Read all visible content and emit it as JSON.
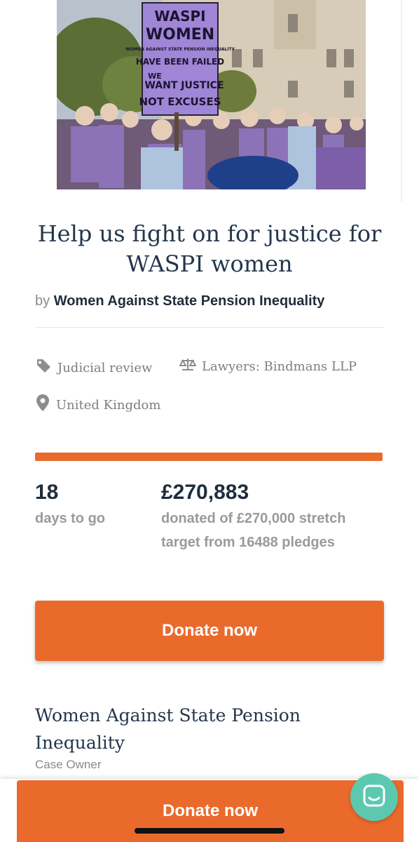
{
  "hero": {
    "image": "campaign-photo",
    "placard_lines": [
      "WASPI",
      "WOMEN",
      "WOMEN AGAINST STATE PENSION INEQUALITY",
      "HAVE BEEN FAILED",
      "WE",
      "WANT JUSTICE",
      "NOT EXCUSES"
    ]
  },
  "campaign": {
    "title": "Help us fight on for justice for WASPI women",
    "by_label": "by",
    "owner": "Women Against State Pension Inequality"
  },
  "meta": {
    "case_type": "Judicial review",
    "lawyers": "Lawyers: Bindmans LLP",
    "location": "United Kingdom",
    "icons": {
      "case_type": "tag-icon",
      "lawyers": "scales-icon",
      "location": "map-pin-icon"
    }
  },
  "stats": {
    "progress_fraction": 1.0,
    "days_left": "18",
    "days_label": "days to go",
    "amount_raised": "£270,883",
    "amount_caption": "donated of £270,000 stretch target from 16488 pledges"
  },
  "actions": {
    "donate_label": "Donate now",
    "sticky_donate_label": "Donate now"
  },
  "case_owner": {
    "name": "Women Against State Pension Inequality",
    "role": "Case Owner"
  },
  "colors": {
    "accent": "#ea6a2c",
    "title": "#24364b",
    "muted": "#8a8a8a",
    "chat": "#5cc8b0"
  }
}
